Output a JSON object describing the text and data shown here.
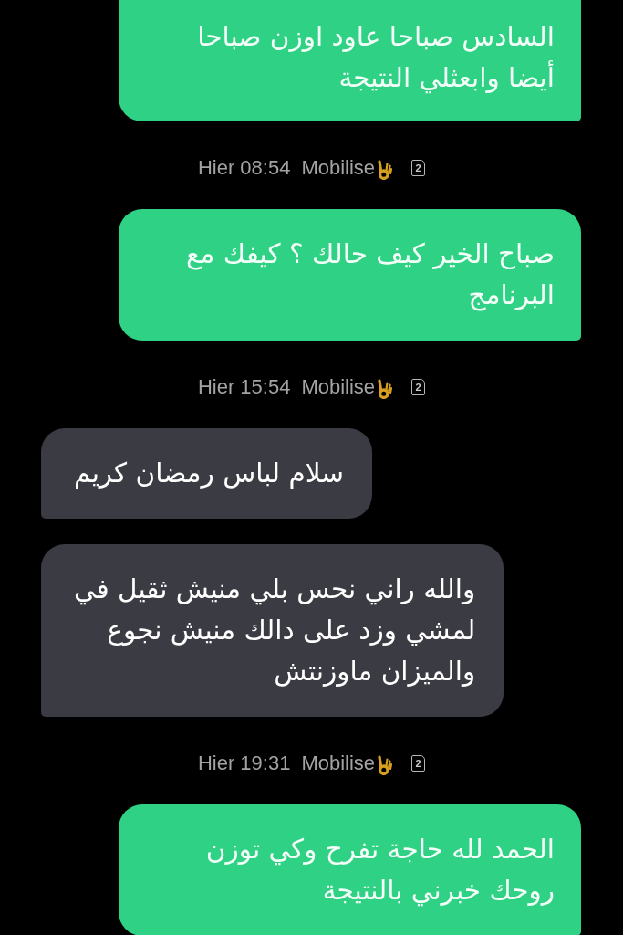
{
  "conversation": [
    {
      "kind": "sent",
      "cut_off": true,
      "text": "السادس صباحا عاود اوزن صباحا\nأيضا وابعثلي النتيجة"
    },
    {
      "kind": "info",
      "time": "Hier 08:54",
      "sender": "Mobilise",
      "sim": "2"
    },
    {
      "kind": "sent",
      "cut_off": false,
      "text": "صباح الخير كيف حالك ؟ كيفك مع\nالبرنامج"
    },
    {
      "kind": "info",
      "time": "Hier 15:54",
      "sender": "Mobilise",
      "sim": "2"
    },
    {
      "kind": "received",
      "cut_off": false,
      "text": "سلام لباس رمضان كريم"
    },
    {
      "kind": "received",
      "cut_off": false,
      "text": "والله راني نحس بلي منيش ثقيل في\nلمشي وزد على دالك منيش نجوع\nوالميزان ماوزنتش"
    },
    {
      "kind": "info",
      "time": "Hier 19:31",
      "sender": "Mobilise",
      "sim": "2"
    },
    {
      "kind": "sent",
      "cut_off": false,
      "text": "الحمد لله حاجة تفرح وكي توزن\nروحك خبرني بالنتيجة"
    }
  ]
}
